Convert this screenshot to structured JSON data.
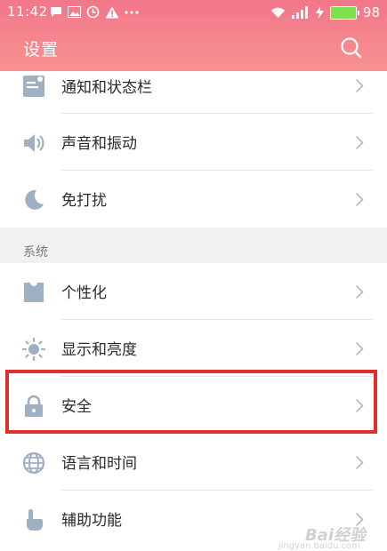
{
  "status_bar": {
    "time": "11:42",
    "battery_level": "98",
    "battery_color": "#7fe04f",
    "left_icons": [
      "message-icon",
      "image-icon",
      "alarm-icon",
      "warning-icon",
      "more-icon"
    ],
    "right_icons": [
      "wifi-icon",
      "signal-icon",
      "charging-icon",
      "battery-icon"
    ]
  },
  "header": {
    "title": "设置",
    "search_icon": "search-icon",
    "gradient": [
      "#f17689",
      "#f7918f"
    ]
  },
  "list": {
    "items_top": [
      {
        "label": "通知和状态栏",
        "icon": "notification-icon"
      },
      {
        "label": "声音和振动",
        "icon": "speaker-icon"
      },
      {
        "label": "免打扰",
        "icon": "moon-icon"
      }
    ],
    "section_label": "系统",
    "items_system": [
      {
        "label": "个性化",
        "icon": "shirt-icon"
      },
      {
        "label": "显示和亮度",
        "icon": "brightness-icon"
      },
      {
        "label": "安全",
        "icon": "lock-icon",
        "highlighted": true
      },
      {
        "label": "语言和时间",
        "icon": "globe-icon"
      },
      {
        "label": "辅助功能",
        "icon": "hand-pointer-icon"
      }
    ]
  },
  "highlight_color": "#e0302d",
  "watermark": {
    "text": "Bai经验",
    "sub": "jingyan.baidu.com"
  }
}
